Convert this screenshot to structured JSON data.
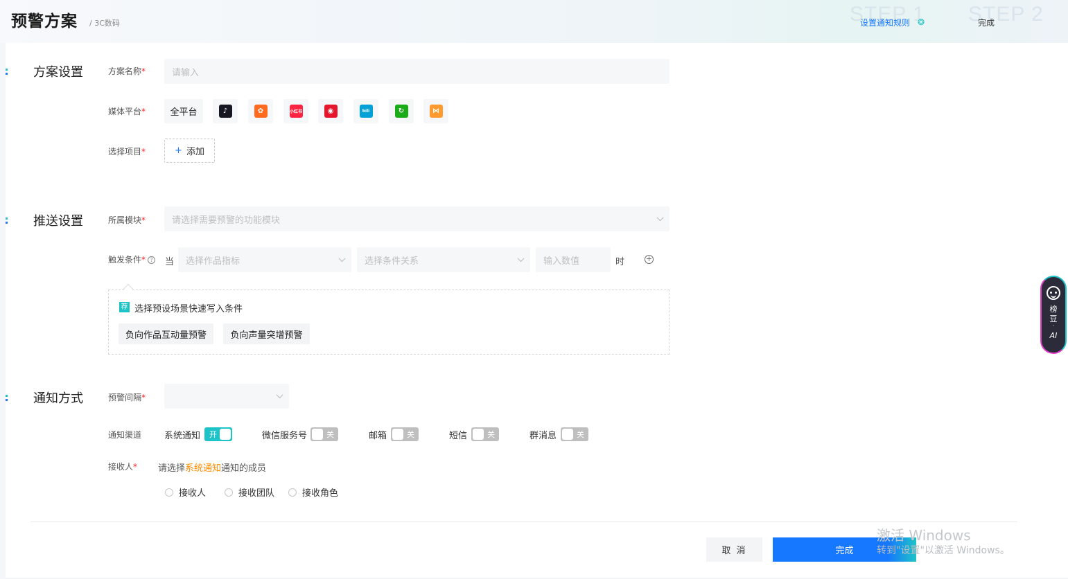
{
  "header": {
    "title": "预警方案",
    "breadcrumb": "/ 3C数码",
    "steps": [
      {
        "bg": "STEP 1",
        "label": "设置通知规则"
      },
      {
        "bg": "STEP 2",
        "label": "完成"
      }
    ]
  },
  "plan_section": {
    "title": "方案设置",
    "name_label": "方案名称",
    "name_placeholder": "请输入",
    "media_label": "媒体平台",
    "all_platforms": "全平台",
    "platform_icons": [
      {
        "name": "douyin-icon",
        "color": "#161823",
        "glyph": "♪"
      },
      {
        "name": "kuaishou-icon",
        "color": "#ff6a1f",
        "glyph": "✿"
      },
      {
        "name": "xiaohongshu-icon",
        "color": "#ff2442",
        "glyph": "小红书"
      },
      {
        "name": "weibo-icon",
        "color": "#e6162d",
        "glyph": "◉"
      },
      {
        "name": "bilibili-icon",
        "color": "#00a1d6",
        "glyph": "bili"
      },
      {
        "name": "wechat-channels-icon",
        "color": "#1aad19",
        "glyph": "↻"
      },
      {
        "name": "other-platform-icon",
        "color": "#ff9a2e",
        "glyph": "⋈"
      }
    ],
    "project_label": "选择项目",
    "add_label": "添加"
  },
  "push_section": {
    "title": "推送设置",
    "module_label": "所属模块",
    "module_placeholder": "请选择需要预警的功能模块",
    "trigger_label": "触发条件",
    "when_text": "当",
    "metric_placeholder": "选择作品指标",
    "relation_placeholder": "选择条件关系",
    "value_placeholder": "输入数值",
    "time_text": "时",
    "preset_badge": "荐",
    "preset_title": "选择预设场景快速写入条件",
    "presets": [
      "负向作品互动量预警",
      "负向声量突增预警"
    ]
  },
  "notify_section": {
    "title": "通知方式",
    "interval_label": "预警间隔",
    "channel_label": "通知渠道",
    "channels": [
      {
        "name": "系统通知",
        "state": "开",
        "on": true
      },
      {
        "name": "微信服务号",
        "state": "关",
        "on": false
      },
      {
        "name": "邮箱",
        "state": "关",
        "on": false
      },
      {
        "name": "短信",
        "state": "关",
        "on": false
      },
      {
        "name": "群消息",
        "state": "关",
        "on": false
      }
    ],
    "receiver_label": "接收人",
    "receiver_hint_prefix": "请选择",
    "receiver_hint_highlight": "系统通知",
    "receiver_hint_suffix": "通知的成员",
    "receiver_options": [
      "接收人",
      "接收团队",
      "接收角色"
    ]
  },
  "footer": {
    "cancel_label": "取 消",
    "done_label": "完成"
  },
  "watermark": {
    "line1": "激活 Windows",
    "line2": "转到\"设置\"以激活 Windows。"
  },
  "ai_widget": {
    "line1": "榜",
    "line2": "豆",
    "dot": "·",
    "line3": "AI"
  },
  "colors": {
    "primary": "#1677ff",
    "accent": "#1ec3c7",
    "highlight": "#ff8a00",
    "required": "#f5222d"
  }
}
